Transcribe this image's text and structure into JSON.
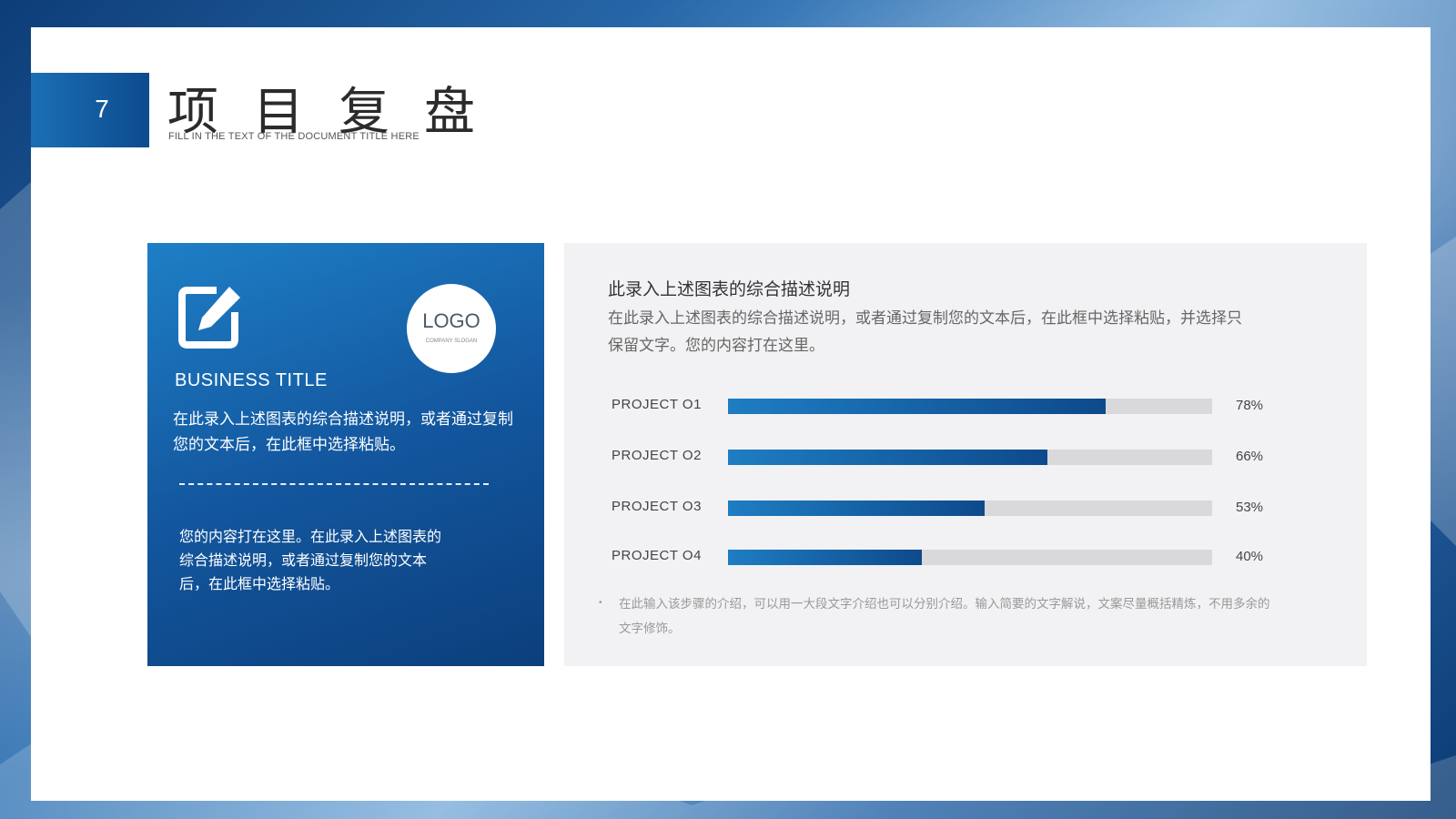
{
  "page": {
    "number": "7"
  },
  "header": {
    "title": "项目复盘",
    "subtitle": "FILL IN THE TEXT OF THE DOCUMENT TITLE HERE"
  },
  "card": {
    "logo_text": "LOGO",
    "logo_slogan": "COMPANY SLOGAN",
    "title": "BUSINESS TITLE",
    "description": "在此录入上述图表的综合描述说明，或者通过复制您的文本后，在此框中选择粘贴。",
    "text2": "您的内容打在这里。在此录入上述图表的综合描述说明，或者通过复制您的文本后，在此框中选择粘贴。"
  },
  "panel": {
    "heading": "此录入上述图表的综合描述说明",
    "description": "在此录入上述图表的综合描述说明，或者通过复制您的文本后，在此框中选择粘贴，并选择只保留文字。您的内容打在这里。",
    "note": "在此输入该步骤的介绍，可以用一大段文字介绍也可以分别介绍。输入简要的文字解说，文案尽量概括精炼，不用多余的文字修饰。"
  },
  "projects": [
    {
      "label": "PROJECT O1",
      "value": 78,
      "pct": "78%"
    },
    {
      "label": "PROJECT O2",
      "value": 66,
      "pct": "66%"
    },
    {
      "label": "PROJECT O3",
      "value": 53,
      "pct": "53%"
    },
    {
      "label": "PROJECT O4",
      "value": 40,
      "pct": "40%"
    }
  ],
  "colors": {
    "accent": "#13579f",
    "accent_light": "#1e7fc6",
    "track": "#d9d9dc",
    "panel_bg": "#f2f2f4"
  }
}
